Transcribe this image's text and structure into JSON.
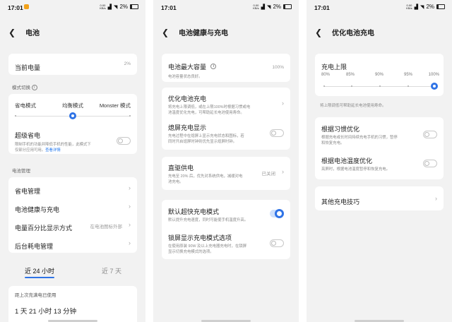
{
  "status": {
    "time": "17:01",
    "net_top": "0.00",
    "net_bottom": "KB/s",
    "battery": "2%"
  },
  "p1": {
    "title": "电池",
    "current": {
      "label": "当前电量",
      "value": "2%"
    },
    "mode_section": "模式切换",
    "modes": [
      "省电模式",
      "均衡模式",
      "Monster 模式"
    ],
    "selected_mode_index": 1,
    "super": {
      "label": "超级省电",
      "desc1": "限制手机的功能并降低手机的性能，此模式下",
      "desc2": "仅部分应用可用。",
      "link": "查看详情",
      "on": false
    },
    "mgmt_section": "电池管理",
    "items": [
      {
        "label": "省电管理",
        "value": ""
      },
      {
        "label": "电池健康与充电",
        "value": ""
      },
      {
        "label": "电量百分比显示方式",
        "value": "在电池图标外部"
      },
      {
        "label": "后台耗电管理",
        "value": ""
      }
    ],
    "tabs": [
      "近 24 小时",
      "近 7 天"
    ],
    "active_tab": 0,
    "since_label": "距上次充满电已使用",
    "since_value": "1 天 21 小时 13 分钟"
  },
  "p2": {
    "title": "电池健康与充电",
    "max_cap": {
      "label": "电池最大容量",
      "desc": "电池容量状态良好。",
      "value": "100%"
    },
    "optimize": {
      "label": "优化电池充电",
      "desc1": "将充电上限调低，或在上限100%时根据习惯或电",
      "desc2": "池温度优化充电，可帮助延长电池使用寿命。"
    },
    "screen_off": {
      "label": "熄屏充电显示",
      "desc1": "充电过程中在熄屏上显示充电状态和图标，若",
      "desc2": "同时开启熄屏时钟则优先显示熄屏时钟。",
      "on": false
    },
    "direct": {
      "label": "直驱供电",
      "desc1": "充电至 20% 后，优先对系统供电，减缓对电",
      "desc2": "池充电。",
      "value": "已关闭"
    },
    "fast": {
      "label": "默认超快充电模式",
      "desc": "默认提升充电速度，同时可能使手机温度升高。",
      "on": true
    },
    "lock": {
      "label": "锁屏显示充电模式选项",
      "desc1": "在使用原装 90W 及以上充电器充电时，在锁屏",
      "desc2": "显示切换充电模式的选项。",
      "on": false
    }
  },
  "p3": {
    "title": "优化电池充电",
    "limit_label": "充电上限",
    "ticks": [
      "80%",
      "85%",
      "90%",
      "95%",
      "100%"
    ],
    "limit_value_percent": 100,
    "limit_note": "将上限调低可帮助延长电池使用寿命。",
    "habit": {
      "label": "根据习惯优化",
      "desc1": "根据充电或长时间持续充电手机的习惯，暂停",
      "desc2": "和恢复充电。",
      "on": false
    },
    "temp": {
      "label": "根据电池温度优化",
      "desc": "亮屏时，根据电池温度暂停和恢复充电。",
      "on": false
    },
    "tips": {
      "label": "其他充电技巧"
    }
  }
}
